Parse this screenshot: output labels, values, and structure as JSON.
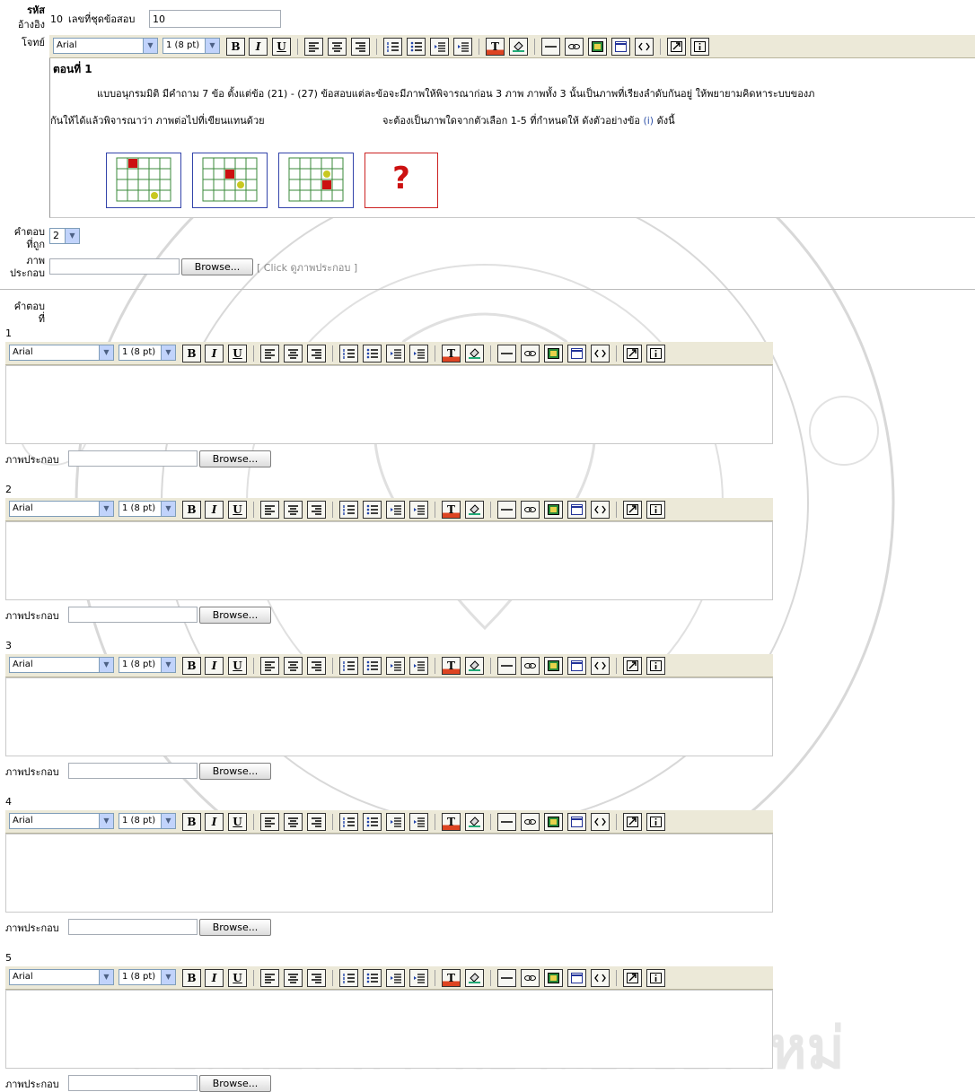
{
  "header": {
    "ref_label_1": "รหัส",
    "ref_label_2": "อ้างอิง",
    "ref_value": "10",
    "set_label": "เลขที่ชุดข้อสอบ",
    "set_value": "10",
    "problem_label": "โจทย์"
  },
  "toolbar": {
    "font_value": "Arial",
    "size_value": "1 (8 pt)",
    "bold": "B",
    "italic": "I",
    "underline": "U",
    "text_color": "T"
  },
  "question": {
    "heading": "ตอนที่ 1",
    "line1": "แบบอนุกรมมิติ มีคำถาม 7 ข้อ ตั้งแต่ข้อ (21) - (27) ข้อสอบแต่ละข้อจะมีภาพให้พิจารณาก่อน 3 ภาพ ภาพทั้ง 3 นั้นเป็นภาพที่เรียงลำดับกันอยู่ ให้พยายามคิดหาระบบของภ",
    "line2a": "กันให้ได้แล้วพิจารณาว่า ภาพต่อไปที่เขียนแทนด้วย",
    "line2b": "จะต้องเป็นภาพใดจากตัวเลือก 1-5 ที่กำหนดให้ ดังตัวอย่างข้อ",
    "line2c": "(i)",
    "line2d": "ดังนี้",
    "question_mark": "?"
  },
  "correct": {
    "label_1": "คำตอบ",
    "label_2": "ที่ถูก",
    "value": "2"
  },
  "image": {
    "label_1": "ภาพ",
    "label_2": "ประกอบ",
    "browse": "Browse...",
    "click_view": "[ Click ดูภาพประกอบ ]"
  },
  "answers_header": {
    "label_1": "คำตอบ",
    "label_2": "ที่"
  },
  "answers": [
    {
      "number": "1",
      "image_label": "ภาพประกอบ",
      "browse": "Browse..."
    },
    {
      "number": "2",
      "image_label": "ภาพประกอบ",
      "browse": "Browse..."
    },
    {
      "number": "3",
      "image_label": "ภาพประกอบ",
      "browse": "Browse..."
    },
    {
      "number": "4",
      "image_label": "ภาพประกอบ",
      "browse": "Browse..."
    },
    {
      "number": "5",
      "image_label": "ภาพประกอบ",
      "browse": "Browse..."
    }
  ],
  "colors": {
    "toolbar_bg": "#ece9d8",
    "grid_line": "#3a8a3a",
    "red_square": "#cc1111",
    "yellow_dot": "#c8c820",
    "frame_blue": "#3344aa",
    "watermark": "#c8c8c8"
  }
}
